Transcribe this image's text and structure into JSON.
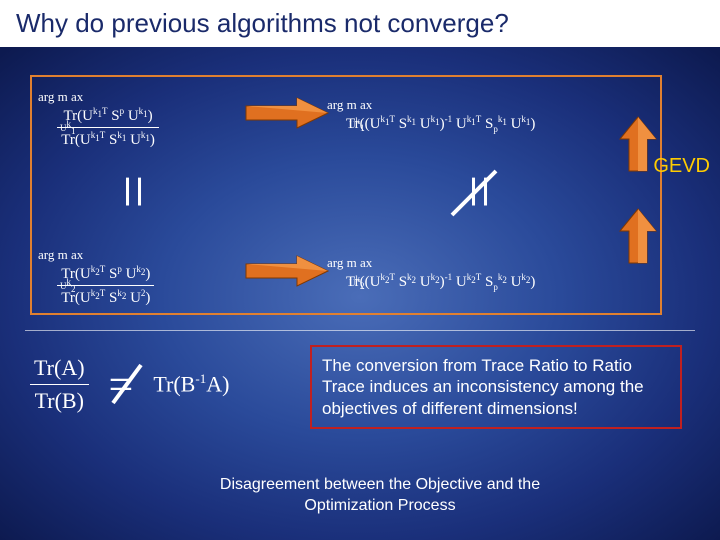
{
  "title": "Why do previous algorithms not converge?",
  "box": {
    "tl": {
      "arg": "arg m ax",
      "sub": "U^{k1}",
      "num": "Tr(U^{k1T} S_p U^{k1})",
      "den": "Tr(U^{k1T} S_l^{k1} U^{k1})"
    },
    "tr": {
      "arg": "arg m ax",
      "sub": "U^{k1}",
      "expr": "Tr((U^{k1T} S^{k1} U^{k1})^{-1} U^{k1T} S_p^{k1} U^{k1})"
    },
    "bl": {
      "arg": "arg m ax",
      "sub": "U^{k2}",
      "num": "Tr(U^{k2T} S_p U^{k2})",
      "den": "Tr(U^{k2T} S^{k2} U^{2})"
    },
    "br": {
      "arg": "arg m ax",
      "sub": "U^{k2}",
      "expr": "Tr((U^{k2T} S^{k2} U^{k2})^{-1} U^{k2T} S_p^{k2} U^{k2})"
    }
  },
  "left_rel": "=",
  "right_rel": "≠",
  "gevd_label": "GEVD",
  "bottom_eq": {
    "lhs_num": "Tr(A)",
    "lhs_den": "Tr(B)",
    "rel": "≠",
    "rhs": "Tr(B^{-1}A)"
  },
  "red_box_text": "The conversion from Trace Ratio to Ratio Trace induces an inconsistency among the objectives of different dimensions!",
  "caption": "Disagreement between the Objective and the Optimization Process"
}
